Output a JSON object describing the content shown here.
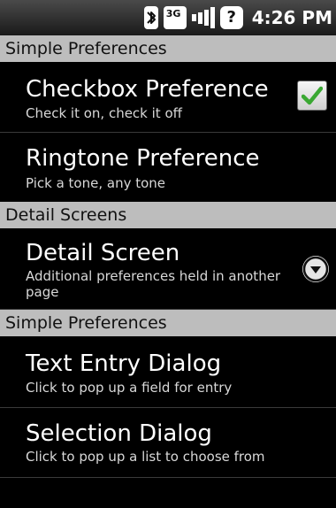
{
  "status_bar": {
    "time": "4:26 PM",
    "network_label": "3G"
  },
  "sections": [
    {
      "header": "Simple Preferences"
    },
    {
      "header": "Detail Screens"
    },
    {
      "header": "Simple Preferences"
    }
  ],
  "items": {
    "checkbox_pref": {
      "title": "Checkbox Preference",
      "summary": "Check it on, check it off",
      "checked": true
    },
    "ringtone_pref": {
      "title": "Ringtone Preference",
      "summary": "Pick a tone, any tone"
    },
    "detail_screen": {
      "title": "Detail Screen",
      "summary_line1": "Additional preferences held in another",
      "summary_line2": "page"
    },
    "text_entry": {
      "title": "Text Entry Dialog",
      "summary": "Click to pop up a field for entry"
    },
    "selection": {
      "title": "Selection Dialog",
      "summary": "Click to pop up a list to choose from"
    }
  },
  "colors": {
    "check": "#3aa832",
    "header_bg": "#bdbdbd",
    "divider": "#3a3a3a"
  }
}
